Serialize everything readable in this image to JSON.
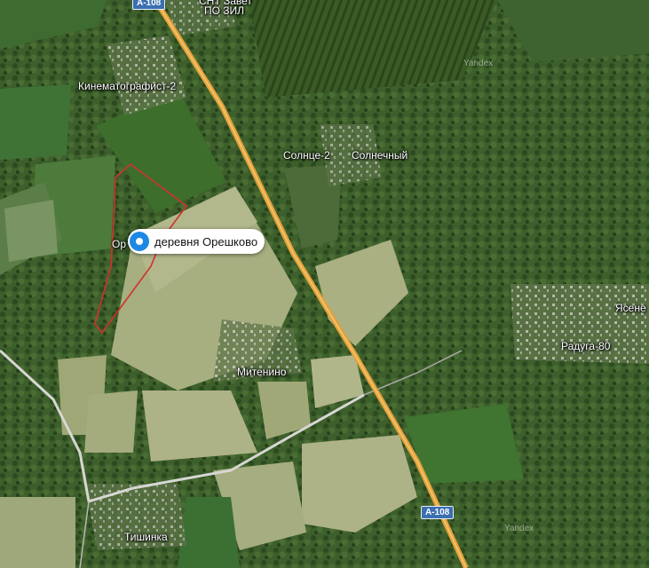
{
  "map": {
    "selected_place": {
      "label": "деревня Орешково"
    },
    "places": {
      "kinematografist": "Кинематографист-2",
      "solntse2": "Солнце-2",
      "solnechny": "Солнечный",
      "oreshkovo_partial": "Ор",
      "mitenino": "Митенино",
      "raduga80": "Радуга-80",
      "yasene": "Ясене",
      "tishinka": "Тишинка",
      "snt_top": "СНТ Завет",
      "po_zil": "ПО ЗИЛ"
    },
    "roads": {
      "a108_top": "А-108",
      "a108_bottom": "А-108"
    },
    "watermarks": {
      "yandex": "Yandex"
    },
    "colors": {
      "road_major": "#e2a03a",
      "area_outline": "#d2312b",
      "pin": "#1e88e5"
    }
  }
}
